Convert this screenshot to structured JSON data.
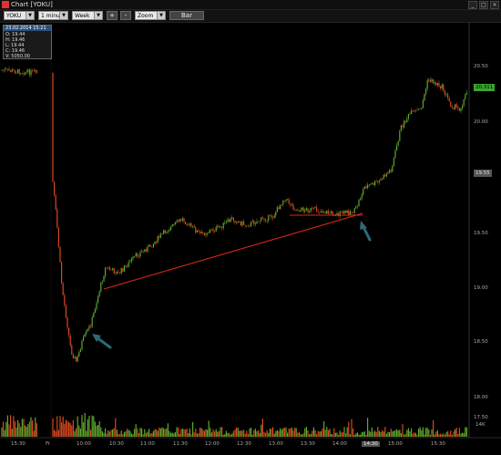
{
  "window": {
    "title": "Chart [YOKU]",
    "controls": [
      "_",
      "□",
      "×"
    ]
  },
  "toolbar": {
    "symbol": "YOKU",
    "interval": "1 minute",
    "range": "Week",
    "plus_label": "+",
    "minus_label": "-",
    "zoom": "Zoom",
    "bar_label": "Bar"
  },
  "ohlc_box": {
    "header": "23.02.2014 15:21",
    "open": "O: 19.44",
    "high": "H: 19.46",
    "low": "L: 19.44",
    "close": "C: 19.46",
    "volume": "V: 5050.00"
  },
  "price_axis": {
    "labels": [
      "20.50",
      "20.00",
      "19.50",
      "19.00",
      "18.50",
      "18.00",
      "17.50"
    ],
    "current_price": "20.311",
    "marker_price": "19.55"
  },
  "volume_axis": {
    "label": "14K"
  },
  "time_axis": {
    "labels": [
      "15:30",
      "Fr",
      "10:00",
      "10:30",
      "11:00",
      "11:30",
      "12:00",
      "12:30",
      "13:00",
      "13:30",
      "14:00",
      "14:30",
      "15:00",
      "15:30"
    ],
    "highlight": "14:30"
  },
  "colors": {
    "background": "#000000",
    "up_candle": "#5ea82b",
    "down_candle": "#d9481f",
    "trendline": "#d8261e",
    "arrow": "#2c6a78",
    "current_price_tag": "#3ca32f"
  }
}
